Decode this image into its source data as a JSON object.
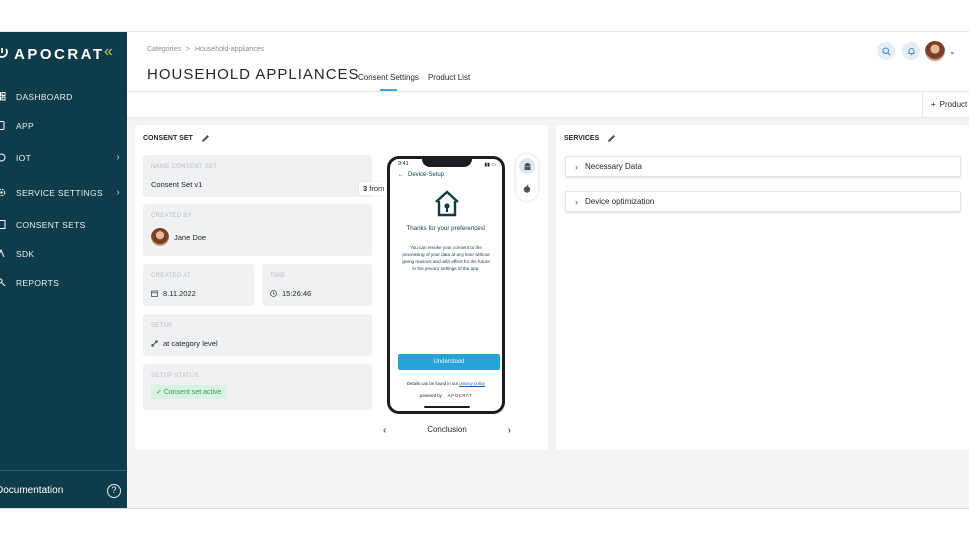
{
  "brand": {
    "name": "APOCRAT",
    "collapse_icon": "double-chevron-left-icon"
  },
  "sidebar": {
    "items": [
      {
        "label": "DASHBOARD",
        "icon": "dashboard-icon"
      },
      {
        "label": "APP",
        "icon": "app-icon"
      },
      {
        "label": "IOT",
        "icon": "iot-icon",
        "has_children": true
      },
      {
        "label": "SERVICE SETTINGS",
        "icon": "settings-icon",
        "has_children": true
      },
      {
        "label": "CONSENT SETS",
        "icon": "consent-icon"
      },
      {
        "label": "SDK",
        "icon": "sdk-icon"
      },
      {
        "label": "REPORTS",
        "icon": "reports-icon"
      }
    ],
    "documentation": "Documentation"
  },
  "header": {
    "breadcrumbs": [
      "Categories",
      ">",
      "Household-appliances"
    ],
    "title": "HOUSEHOLD APPLIANCES",
    "tabs": [
      {
        "label": "Consent Settings",
        "active": true
      },
      {
        "label": "Product List",
        "active": false
      }
    ]
  },
  "toolbar": {
    "add_product": "Product"
  },
  "consent_set": {
    "title": "CONSENT SET",
    "name_label": "NAME CONSENT SET",
    "name_value": "Consent Set v1",
    "created_by_label": "CREATED BY",
    "created_by_value": "Jane Doe",
    "created_at_label": "CREATED AT",
    "created_at_value": "8.11.2022",
    "time_label": "TIME",
    "time_value": "15:26:46",
    "setup_label": "SETUP",
    "setup_value": "at category level",
    "status_label": "SETUP STATUS",
    "status_value": "Consent set active"
  },
  "preview": {
    "step_current": "3",
    "step_from": "from 3",
    "time": "9:41",
    "back_label": "Device-Setup",
    "thanks": "Thanks for your preferences!",
    "body": "You can revoke your consent to the processing of your data at any time without giving reasons and with effect for the future in the privacy settings of the app.",
    "button": "Understood",
    "footer_text": "Details can be found in our",
    "footer_link": "privacy policy",
    "powered_by": "powered by",
    "powered_brand": "APOCRAT",
    "pager_label": "Conclusion"
  },
  "services": {
    "title": "SERVICES",
    "items": [
      "Necessary Data",
      "Device optimization"
    ]
  },
  "colors": {
    "sidebar_bg": "#0f3c4b",
    "accent": "#26a3d8",
    "brand_accent": "#d8c44a",
    "success": "#2e9e57"
  }
}
